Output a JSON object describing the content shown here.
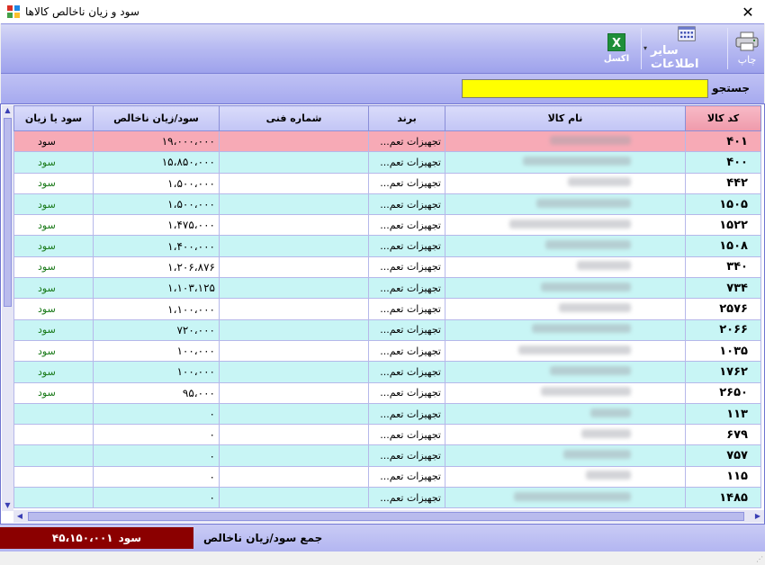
{
  "window": {
    "title": "سود و زیان ناخالص کالاها",
    "close_glyph": "✕"
  },
  "toolbar": {
    "print_label": "چاپ",
    "other_info_label": "سایر اطلاعات",
    "dropdown_glyph": "▾",
    "excel_label": "اکسل",
    "excel_icon_text": "X"
  },
  "search": {
    "label": "جستجو",
    "value": ""
  },
  "grid": {
    "columns": [
      "کد کالا",
      "نام کالا",
      "برند",
      "شماره فنی",
      "سود/زیان ناخالص",
      "سود یا زیان"
    ],
    "rows": [
      {
        "code": "۴۰۱",
        "brand": "تجهیزات تعم...",
        "profit": "۱۹،۰۰۰،۰۰۰",
        "status": "سود",
        "selected": true
      },
      {
        "code": "۴۰۰",
        "brand": "تجهیزات تعم...",
        "profit": "۱۵،۸۵۰،۰۰۰",
        "status": "سود"
      },
      {
        "code": "۴۴۲",
        "brand": "تجهیزات تعم...",
        "profit": "۱،۵۰۰،۰۰۰",
        "status": "سود"
      },
      {
        "code": "۱۵۰۵",
        "brand": "تجهیزات تعم...",
        "profit": "۱،۵۰۰،۰۰۰",
        "status": "سود"
      },
      {
        "code": "۱۵۲۲",
        "brand": "تجهیزات تعم...",
        "profit": "۱،۴۷۵،۰۰۰",
        "status": "سود"
      },
      {
        "code": "۱۵۰۸",
        "brand": "تجهیزات تعم...",
        "profit": "۱،۴۰۰،۰۰۰",
        "status": "سود"
      },
      {
        "code": "۳۴۰",
        "brand": "تجهیزات تعم...",
        "profit": "۱،۲۰۶،۸۷۶",
        "status": "سود"
      },
      {
        "code": "۷۳۴",
        "brand": "تجهیزات تعم...",
        "profit": "۱،۱۰۳،۱۲۵",
        "status": "سود"
      },
      {
        "code": "۲۵۷۶",
        "brand": "تجهیزات تعم...",
        "profit": "۱،۱۰۰،۰۰۰",
        "status": "سود"
      },
      {
        "code": "۲۰۶۶",
        "brand": "تجهیزات تعم...",
        "profit": "۷۲۰،۰۰۰",
        "status": "سود"
      },
      {
        "code": "۱۰۳۵",
        "brand": "تجهیزات تعم...",
        "profit": "۱۰۰،۰۰۰",
        "status": "سود"
      },
      {
        "code": "۱۷۶۲",
        "brand": "تجهیزات تعم...",
        "profit": "۱۰۰،۰۰۰",
        "status": "سود"
      },
      {
        "code": "۲۶۵۰",
        "brand": "تجهیزات تعم...",
        "profit": "۹۵،۰۰۰",
        "status": "سود"
      },
      {
        "code": "۱۱۳",
        "brand": "تجهیزات تعم...",
        "profit": "۰",
        "status": ""
      },
      {
        "code": "۶۷۹",
        "brand": "تجهیزات تعم...",
        "profit": "۰",
        "status": ""
      },
      {
        "code": "۷۵۷",
        "brand": "تجهیزات تعم...",
        "profit": "۰",
        "status": ""
      },
      {
        "code": "۱۱۵",
        "brand": "تجهیزات تعم...",
        "profit": "۰",
        "status": ""
      },
      {
        "code": "۱۴۸۵",
        "brand": "تجهیزات تعم...",
        "profit": "۰",
        "status": ""
      }
    ]
  },
  "footer": {
    "total_label": "جمع سود/زیان ناخالص",
    "total_value": "۴۵،۱۵۰،۰۰۱",
    "total_status": "سود"
  },
  "colors": {
    "selected_row": "#f7aab6",
    "alt_row": "#c8f5f5",
    "profit_text": "#1a7a1a",
    "total_bg": "#8b0000",
    "search_bg": "#ffff00"
  }
}
